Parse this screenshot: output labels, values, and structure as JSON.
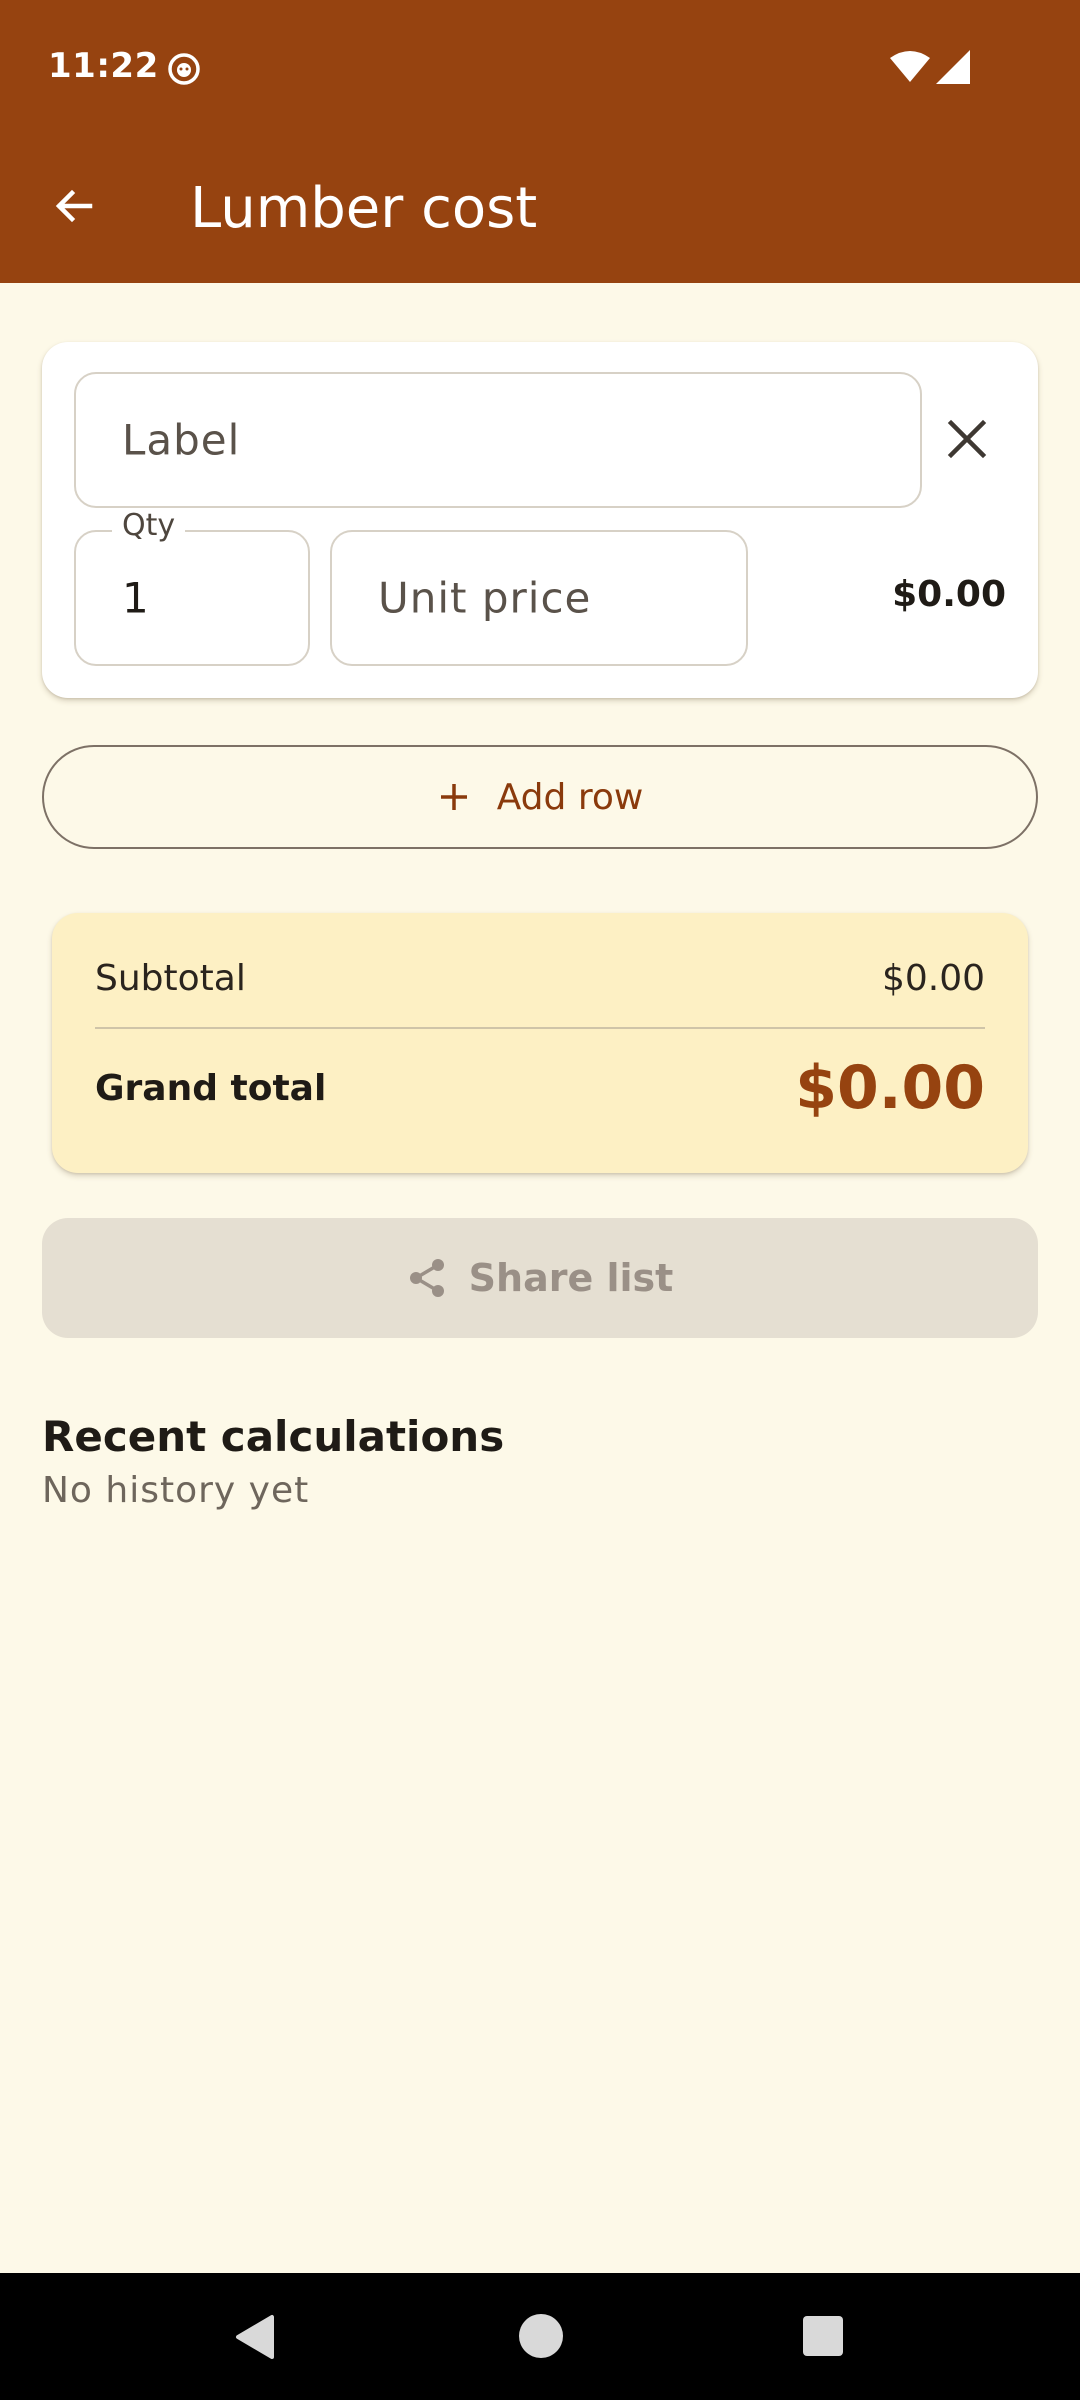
{
  "status_bar": {
    "time": "11:22",
    "app_icon": "cat-face-icon",
    "wifi_icon": "wifi-icon",
    "signal_icon": "signal-icon"
  },
  "app_bar": {
    "title": "Lumber cost",
    "back_icon": "arrow-back-icon"
  },
  "items": [
    {
      "label_placeholder": "Label",
      "label_value": "",
      "qty_label": "Qty",
      "qty_value": "1",
      "unit_price_placeholder": "Unit price",
      "unit_price_value": "",
      "row_total": "$0.00",
      "remove_icon": "close-icon"
    }
  ],
  "add_row": {
    "label": "Add row",
    "icon": "plus-icon"
  },
  "totals": {
    "subtotal_label": "Subtotal",
    "subtotal_value": "$0.00",
    "grand_total_label": "Grand total",
    "grand_total_value": "$0.00"
  },
  "share": {
    "label": "Share list",
    "icon": "share-icon",
    "enabled": false
  },
  "history": {
    "title": "Recent calculations",
    "empty_text": "No history yet"
  },
  "colors": {
    "primary": "#964310",
    "background": "#FDF9E8",
    "card": "#FFFFFF",
    "totals_card": "#FDF0C4",
    "disabled_button": "#E5DFD2"
  }
}
